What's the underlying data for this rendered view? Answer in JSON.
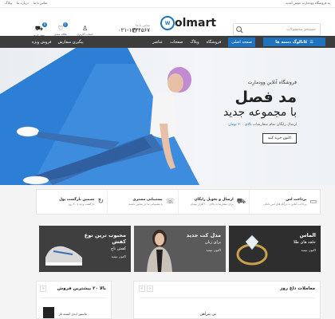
{
  "topbar": {
    "message": "به فروشگاه وودمارت خوش آمدید",
    "links": [
      "تماس با ما",
      "درباره ما",
      "وبلاگ"
    ]
  },
  "header": {
    "logo": "olmart",
    "search_placeholder": "جستجو محصولات",
    "phone_label": "تماس با ما",
    "phone_number": "۰۲۱-۱۲۳۴۵۶۷",
    "icons": [
      {
        "name": "cart",
        "label": "سبد خرید",
        "badge": "0"
      },
      {
        "name": "wishlist",
        "label": "علاقه مندی",
        "badge": "0"
      },
      {
        "name": "account",
        "label": "حساب کاربری",
        "badge": ""
      }
    ]
  },
  "nav": {
    "categories_button": "کاتالوگ دسته ها",
    "menu": [
      "صفحه اصلی",
      "فروشگاه",
      "وبلاگ",
      "صفحات",
      "عناصر"
    ],
    "extra": [
      "پیگیری سفارش",
      "فروش ویژه"
    ]
  },
  "hero": {
    "subtitle": "فروشگاه آنلاین وودمارت",
    "title_line1": "مد فصل",
    "title_line2": "با مجموعه جدید",
    "description_prefix": "ارسال رایگان تمام سفارشات",
    "description_highlight": "بالای ۲۰۰ تومان",
    "button": "اکنون خرید کنید"
  },
  "features": [
    {
      "title": "پرداخت امن",
      "desc": "پرداخت آنلاین با درگاه های امن بانکی",
      "icon": "card"
    },
    {
      "title": "ارسال و تحویل رایگان",
      "desc": "برای سفارشات بالای ۲۰۰ هزار تومان",
      "icon": "truck"
    },
    {
      "title": "پشتیبانی مشتری",
      "desc": "با پشتیبانی ما در تماس باشید",
      "icon": "chat"
    },
    {
      "title": "تضمین بازگشت پول",
      "desc": "بازگشت وجه تا ۳۰ روز",
      "icon": "refresh"
    }
  ],
  "promos": [
    {
      "title": "الماس",
      "subtitle": "حلقه های طلا",
      "cta": "اکنون ببینید"
    },
    {
      "title": "مدل کت جدید",
      "subtitle": "برای زنان",
      "cta": "اکنون ببینید"
    },
    {
      "title": "محبوب ترین نوع کفش",
      "subtitle": "کفش ناچ",
      "cta": "اکنون ببینید"
    }
  ],
  "panels": {
    "right_title": "معاملات داغ روز",
    "left_title": "بالا ۲۰ بیشترین فروش",
    "right_product": "تی پیراهن",
    "left_product": "مانیتور ایدی کیسه بار"
  },
  "colors": {
    "accent": "#1e73be",
    "nav": "#3d3d3d",
    "promo_dark": "#3a3a3a"
  }
}
